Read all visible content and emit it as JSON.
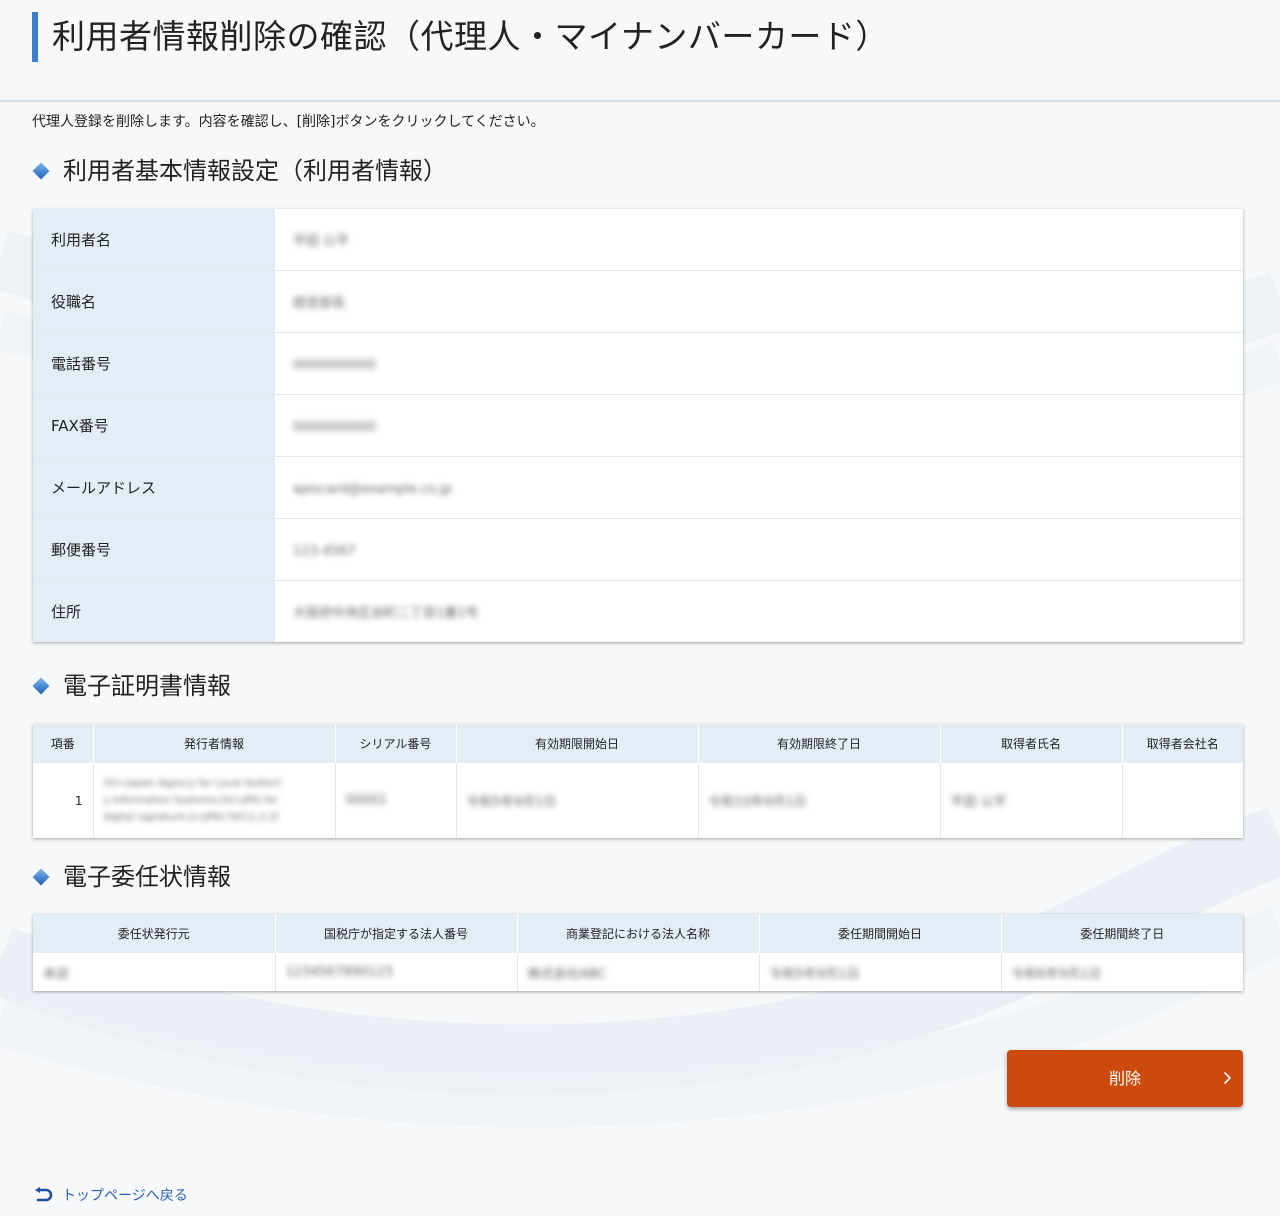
{
  "page": {
    "title": "利用者情報削除の確認（代理人・マイナンバーカード）",
    "description": "代理人登録を削除します。内容を確認し、[削除]ボタンをクリックしてください。"
  },
  "user_section": {
    "title": "利用者基本情報設定（利用者情報）",
    "rows": [
      {
        "label": "利用者名",
        "value": "平田 公平"
      },
      {
        "label": "役職名",
        "value": "経営部長"
      },
      {
        "label": "電話番号",
        "value": "0000000000"
      },
      {
        "label": "FAX番号",
        "value": "0000000000"
      },
      {
        "label": "メールアドレス",
        "value": "ajescard@example.co.jp"
      },
      {
        "label": "郵便番号",
        "value": "123-4567"
      },
      {
        "label": "住所",
        "value": "大阪府中央区谷町二丁目1番1号"
      }
    ]
  },
  "cert_section": {
    "title": "電子証明書情報",
    "headers": [
      "項番",
      "発行者情報",
      "シリアル番号",
      "有効期限開始日",
      "有効期限終了日",
      "取得者氏名",
      "取得者会社名"
    ],
    "row": {
      "number": "1",
      "issuer_lines": [
        "OU=Japan Agency for Local Authori",
        "y Information Systems,OU=JPKI for",
        "digital signature,O=JPKI,*DC(1,2,3)"
      ],
      "serial": "00001",
      "valid_from": "令和5年9月1日",
      "valid_to": "令和10年9月1日",
      "holder_name": "平田 公平",
      "holder_company": ""
    }
  },
  "proxy_section": {
    "title": "電子委任状情報",
    "headers": [
      "委任状発行元",
      "国税庁が指定する法人番号",
      "商業登記における法人名称",
      "委任期間開始日",
      "委任期間終了日"
    ],
    "row": {
      "issuer": "本店",
      "corporate_number": "1234567890123",
      "corporate_name": "株式会社ABC",
      "start_date": "令和5年9月1日",
      "end_date": "令和6年9月1日"
    }
  },
  "actions": {
    "delete_label": "削除",
    "back_link": "トップページへ戻る"
  },
  "colors": {
    "accent_blue": "#3a7fd0",
    "header_cell_bg": "#e4ecf6",
    "delete_button": "#cc4a0c",
    "link": "#2b63b7"
  },
  "icons": {
    "section_bullet": "diamond-icon",
    "button_chevron": "chevron-right-icon",
    "back": "return-arrow-icon"
  }
}
